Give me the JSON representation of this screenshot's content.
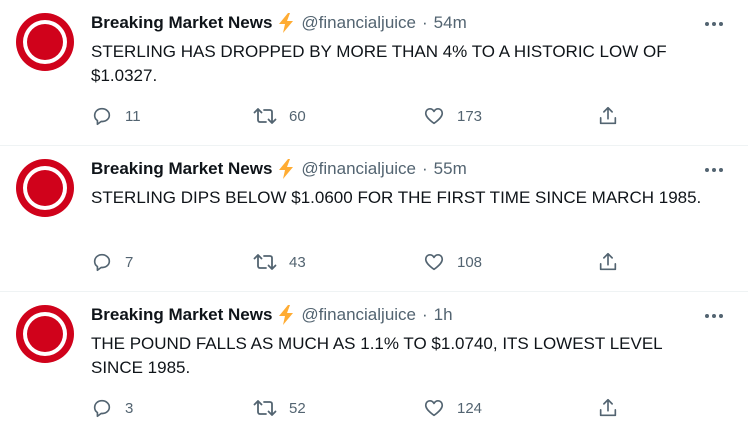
{
  "tweets": [
    {
      "author": "Breaking Market News",
      "handle": "@financialjuice",
      "separator": "·",
      "time": "54m",
      "text": "STERLING HAS DROPPED BY MORE THAN 4% TO A HISTORIC LOW OF $1.0327.",
      "replies": "11",
      "retweets": "60",
      "likes": "173"
    },
    {
      "author": "Breaking Market News",
      "handle": "@financialjuice",
      "separator": "·",
      "time": "55m",
      "text": "STERLING DIPS BELOW $1.0600 FOR THE FIRST TIME SINCE MARCH 1985.",
      "replies": "7",
      "retweets": "43",
      "likes": "108"
    },
    {
      "author": "Breaking Market News",
      "handle": "@financialjuice",
      "separator": "·",
      "time": "1h",
      "text": "THE POUND FALLS AS MUCH AS 1.1% TO $1.0740, ITS LOWEST LEVEL SINCE 1985.",
      "replies": "3",
      "retweets": "52",
      "likes": "124"
    }
  ],
  "icons": {
    "avatar": "red-ring-logo",
    "verified_emoji": "lightning-bolt-icon",
    "more": "more-horizontal-icon",
    "reply": "reply-icon",
    "retweet": "retweet-icon",
    "like": "heart-icon",
    "share": "share-icon"
  },
  "colors": {
    "avatar_red": "#d0021b",
    "bolt": "#ffac33",
    "muted": "#536471",
    "text": "#0f1419"
  }
}
